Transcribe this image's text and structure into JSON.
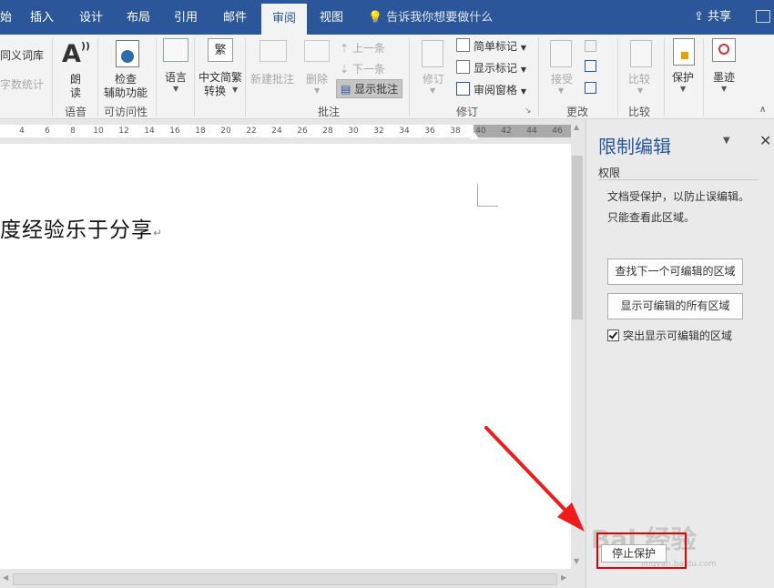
{
  "tabs": [
    "始",
    "插入",
    "设计",
    "布局",
    "引用",
    "邮件",
    "审阅",
    "视图"
  ],
  "active_tab": "审阅",
  "tell_me": "告诉我你想要做什么",
  "share": "共享",
  "ribbon": {
    "thesaurus": "同义词库",
    "word_count": "字数统计",
    "read_aloud_1": "朗",
    "read_aloud_2": "读",
    "group_speech": "语音",
    "check_access_1": "检查",
    "check_access_2": "辅助功能",
    "group_accessibility": "可访问性",
    "language": "语言",
    "chinese_convert_1": "中文简繁",
    "chinese_convert_2": "转换",
    "new_comment": "新建批注",
    "delete": "删除",
    "previous": "上一条",
    "next": "下一条",
    "show_comments": "显示批注",
    "group_comments": "批注",
    "track": "修订",
    "simple_markup": "简单标记",
    "show_markup": "显示标记",
    "review_pane": "审阅窗格",
    "group_tracking": "修订",
    "accept": "接受",
    "group_changes": "更改",
    "compare": "比较",
    "group_compare": "比较",
    "protect": "保护",
    "ink": "墨迹"
  },
  "ruler_ticks": [
    "4",
    "6",
    "8",
    "10",
    "12",
    "14",
    "16",
    "18",
    "20",
    "22",
    "24",
    "26",
    "28",
    "30",
    "32",
    "34",
    "36",
    "38",
    "40",
    "42",
    "44",
    "46"
  ],
  "doc_text": "度经验乐于分享",
  "pane": {
    "title": "限制编辑",
    "permissions": "权限",
    "msg1": "文档受保护，以防止误编辑。",
    "msg2": "只能查看此区域。",
    "find_next": "查找下一个可编辑的区域",
    "show_all": "显示可编辑的所有区域",
    "highlight": "突出显示可编辑的区域",
    "stop": "停止保护"
  },
  "watermark": "Bai 经验",
  "watermark_sub": "jingyan.baidu.com",
  "colors": {
    "accent": "#2b579a",
    "highlight_box": "#e60000",
    "arrow": "#ee1c1c"
  }
}
